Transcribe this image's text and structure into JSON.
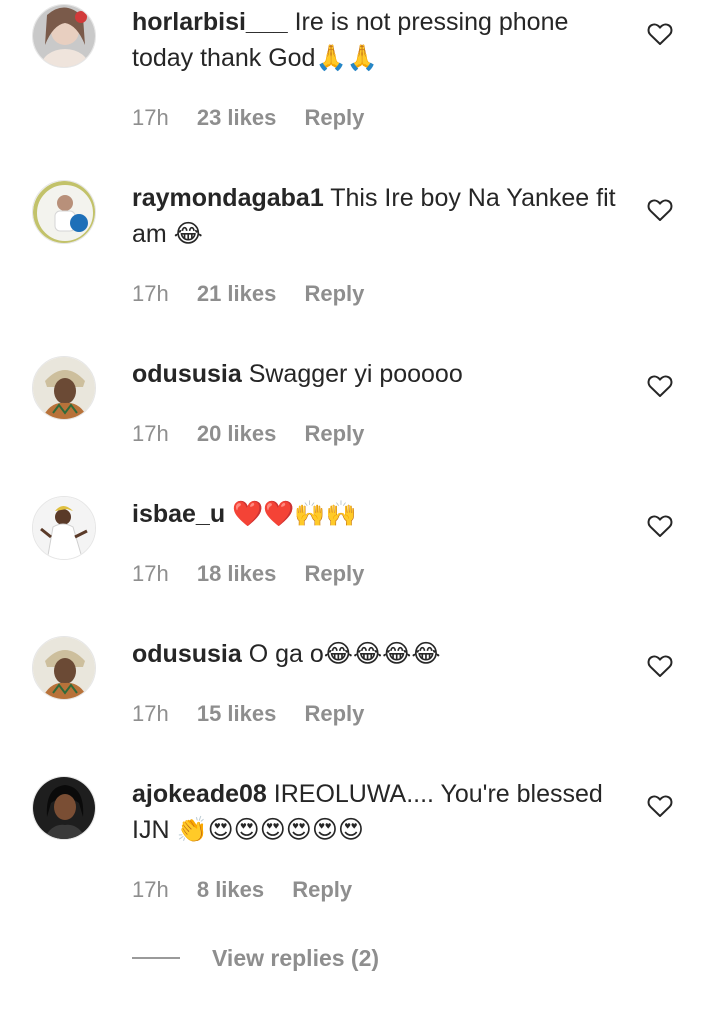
{
  "comments": [
    {
      "username": "horlarbisi___",
      "text": "Ire is not pressing phone today thank God🙏🙏",
      "time": "17h",
      "likes": "23 likes",
      "reply": "Reply",
      "avatar_icon": "user-avatar-photo"
    },
    {
      "username": "raymondagaba1",
      "text": "This Ire boy Na Yankee fit am 😂",
      "time": "17h",
      "likes": "21 likes",
      "reply": "Reply",
      "avatar_icon": "user-avatar-photo"
    },
    {
      "username": "odususia",
      "text": "Swagger yi pooooo",
      "time": "17h",
      "likes": "20 likes",
      "reply": "Reply",
      "avatar_icon": "user-avatar-photo"
    },
    {
      "username": "isbae_u",
      "text": "❤️❤️🙌🙌",
      "time": "17h",
      "likes": "18 likes",
      "reply": "Reply",
      "avatar_icon": "user-avatar-photo"
    },
    {
      "username": "odususia",
      "text": "O ga o😂😂😂😂",
      "time": "17h",
      "likes": "15 likes",
      "reply": "Reply",
      "avatar_icon": "user-avatar-photo"
    },
    {
      "username": "ajokeade08",
      "text": "IREOLUWA.... You're blessed IJN 👏😍😍😍😍😍😍",
      "time": "17h",
      "likes": "8 likes",
      "reply": "Reply",
      "avatar_icon": "user-avatar-photo"
    }
  ],
  "view_replies": {
    "label": "View replies (2)"
  },
  "colors": {
    "text": "#262626",
    "meta": "#8e8e8e",
    "heart_outline": "#262626"
  }
}
